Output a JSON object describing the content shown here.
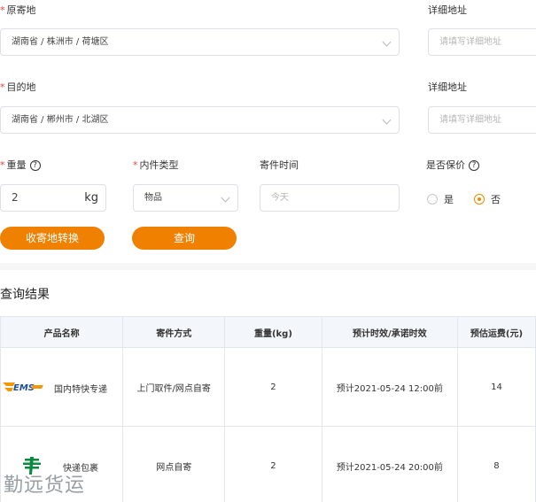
{
  "form": {
    "origin": {
      "label": "原寄地",
      "value": "湖南省 / 株洲市 / 荷塘区"
    },
    "origin_detail": {
      "label": "详细地址",
      "placeholder": "请填写详细地址"
    },
    "destination": {
      "label": "目的地",
      "value": "湖南省 / 郴州市 / 北湖区"
    },
    "destination_detail": {
      "label": "详细地址",
      "placeholder": "请填写详细地址"
    },
    "weight": {
      "label": "重量",
      "value": "2",
      "unit": "kg",
      "help": "?"
    },
    "item_type": {
      "label": "内件类型",
      "value": "物品"
    },
    "send_time": {
      "label": "寄件时间",
      "placeholder": "今天"
    },
    "insured": {
      "label": "是否保价",
      "help": "?",
      "options": [
        "是",
        "否"
      ],
      "selected": "否"
    },
    "swap_button": "收寄地转换",
    "query_button": "查询"
  },
  "results": {
    "title": "查询结果",
    "columns": [
      "产品名称",
      "寄件方式",
      "重量(kg)",
      "预计时效/承诺时效",
      "预估运费(元)"
    ],
    "rows": [
      {
        "logo": "ems-logo",
        "logo_text": "EMS",
        "product": "国内特快专递",
        "method": "上门取件/网点自寄",
        "weight": "2",
        "eta": "预计2021-05-24 12:00前",
        "fee": "14"
      },
      {
        "logo": "china-post-logo",
        "product": "快递包裹",
        "method": "网点自寄",
        "weight": "2",
        "eta": "预计2021-05-24 20:00前",
        "fee": "8"
      }
    ]
  },
  "watermark": "勤远货运",
  "colors": {
    "accent": "#f08000",
    "required": "#f04134",
    "header_bg": "#f3f6fb",
    "ems_blue": "#1d4f9a",
    "ems_orange": "#f39800",
    "post_green": "#0a8a3c"
  }
}
